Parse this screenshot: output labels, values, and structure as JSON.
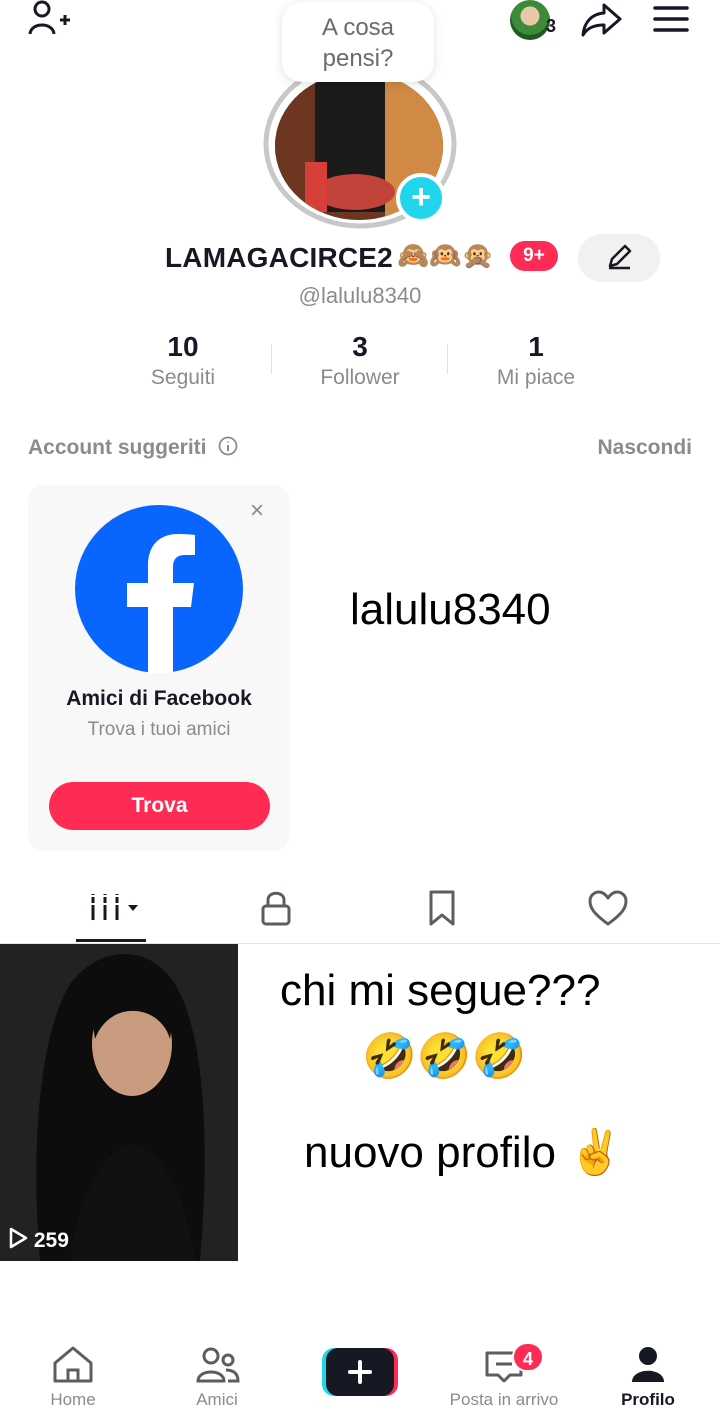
{
  "thought_bubble": {
    "line1": "A cosa",
    "line2": "pensi?"
  },
  "header": {
    "story_count": "3",
    "icons": [
      "add-friend-icon",
      "share-icon",
      "menu-icon"
    ]
  },
  "profile": {
    "display_name": "LAMAGACIRCE2",
    "name_emojis": "🙈🙉🙊",
    "badge": "9+",
    "username": "@lalulu8340"
  },
  "stats": [
    {
      "value": "10",
      "label": "Seguiti"
    },
    {
      "value": "3",
      "label": "Follower"
    },
    {
      "value": "1",
      "label": "Mi piace"
    }
  ],
  "suggested": {
    "title": "Account suggeriti",
    "hide": "Nascondi",
    "card": {
      "close": "×",
      "title": "Amici di Facebook",
      "subtitle": "Trova i tuoi amici",
      "button": "Trova"
    },
    "handle_overlay": "lalulu8340"
  },
  "tabs": [
    "videos-tab",
    "private-tab",
    "saved-tab",
    "liked-tab"
  ],
  "video": {
    "views": "259"
  },
  "caption": {
    "line1": "chi mi segue???",
    "line2": "🤣🤣🤣",
    "line3": "nuovo profilo ✌️"
  },
  "bottom_nav": {
    "home": "Home",
    "friends": "Amici",
    "inbox": "Posta in arrivo",
    "inbox_badge": "4",
    "profile": "Profilo"
  },
  "colors": {
    "accent": "#fe2c55",
    "cyan": "#20d5ec",
    "facebook": "#0866ff",
    "text": "#161823",
    "muted": "#8a8b91"
  }
}
